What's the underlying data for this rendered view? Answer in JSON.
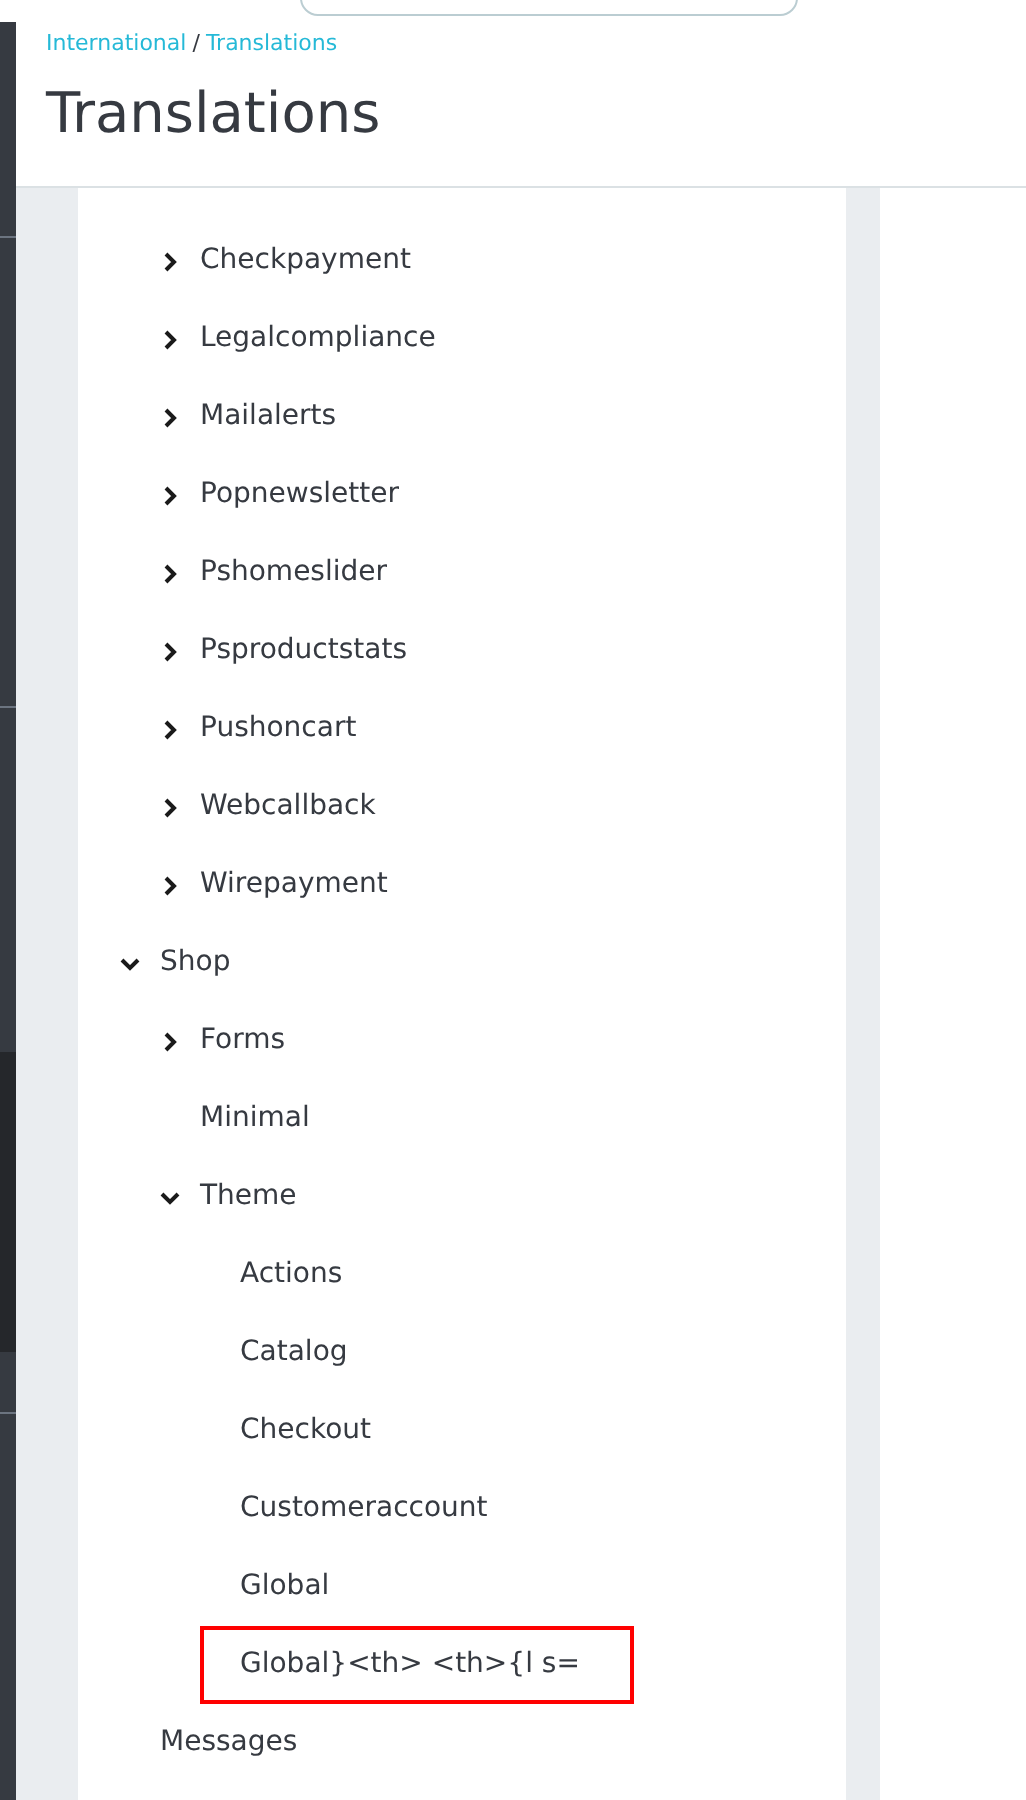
{
  "breadcrumb": [
    {
      "label": "International"
    },
    {
      "label": "Translations"
    }
  ],
  "breadcrumb_separator": "/",
  "title": "Translations",
  "tree": [
    {
      "children": [
        {
          "label": "Checkpayment",
          "expanded": false
        },
        {
          "label": "Legalcompliance",
          "expanded": false
        },
        {
          "label": "Mailalerts",
          "expanded": false
        },
        {
          "label": "Popnewsletter",
          "expanded": false
        },
        {
          "label": "Pshomeslider",
          "expanded": false
        },
        {
          "label": "Psproductstats",
          "expanded": false
        },
        {
          "label": "Pushoncart",
          "expanded": false
        },
        {
          "label": "Webcallback",
          "expanded": false
        },
        {
          "label": "Wirepayment",
          "expanded": false
        }
      ]
    },
    {
      "label": "Shop",
      "expanded": true,
      "children": [
        {
          "label": "Forms",
          "expanded": false
        },
        {
          "label": "Minimal"
        },
        {
          "label": "Theme",
          "expanded": true,
          "children": [
            {
              "label": "Actions"
            },
            {
              "label": "Catalog"
            },
            {
              "label": "Checkout"
            },
            {
              "label": "Customeraccount"
            },
            {
              "label": "Global"
            },
            {
              "label": "Global}<th> <th>{l s=",
              "highlighted": true
            }
          ]
        }
      ]
    },
    {
      "label": "Messages"
    }
  ]
}
